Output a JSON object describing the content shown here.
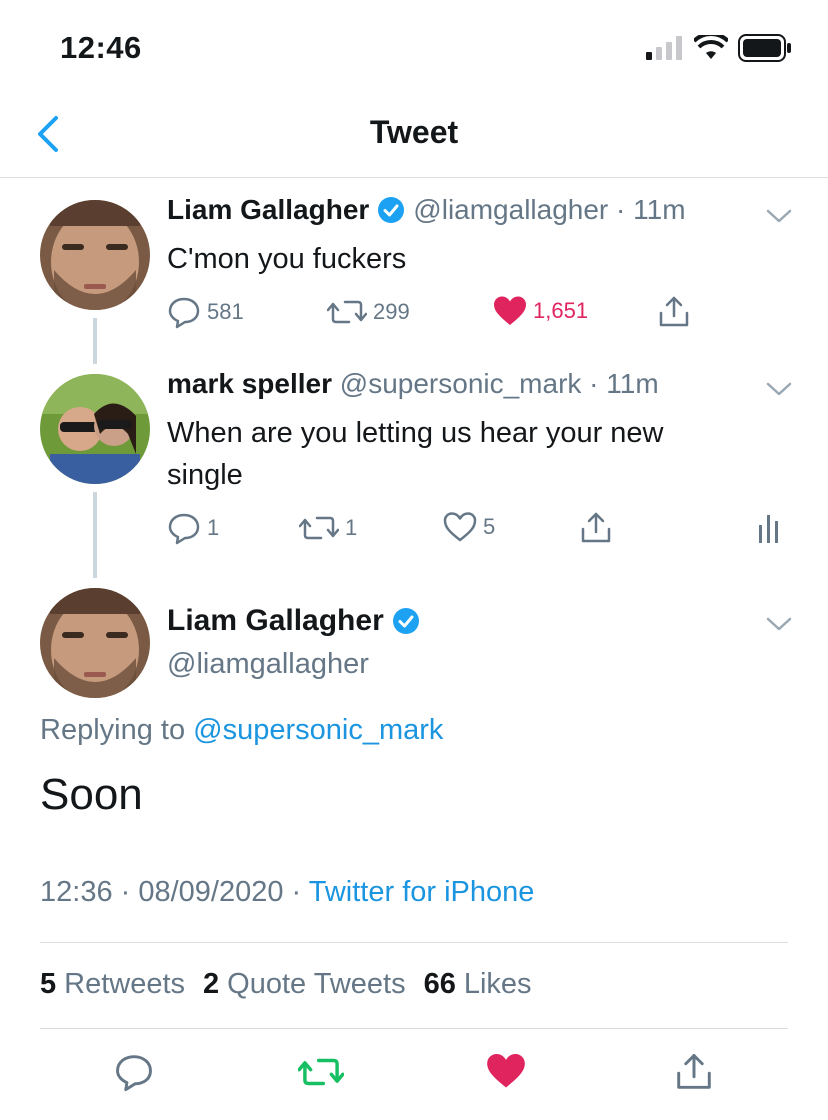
{
  "status_bar": {
    "time": "12:46"
  },
  "nav": {
    "title": "Tweet"
  },
  "tweets": [
    {
      "name": "Liam Gallagher",
      "handle": "@liamgallagher",
      "time": "11m",
      "text": "C'mon you fuckers",
      "replies": "581",
      "retweets": "299",
      "likes": "1,651",
      "liked": true
    },
    {
      "name": "mark speller",
      "handle": "@supersonic_mark",
      "time": "11m",
      "text": "When are you letting us hear your new single",
      "replies": "1",
      "retweets": "1",
      "likes": "5",
      "liked": false
    }
  ],
  "main_tweet": {
    "name": "Liam Gallagher",
    "handle": "@liamgallagher",
    "replying_prefix": "Replying to",
    "replying_to": "@supersonic_mark",
    "text": "Soon",
    "timestamp": "12:36 · 08/09/2020 · ",
    "source": "Twitter for iPhone",
    "stats": {
      "retweets_count": "5",
      "retweets_label": "Retweets",
      "quotes_count": "2",
      "quotes_label": "Quote Tweets",
      "likes_count": "66",
      "likes_label": "Likes"
    }
  },
  "colors": {
    "accent": "#1b95e0",
    "like": "#e0245e",
    "retweet": "#17bf63",
    "muted": "#657786",
    "verified": "#1da1f2"
  }
}
